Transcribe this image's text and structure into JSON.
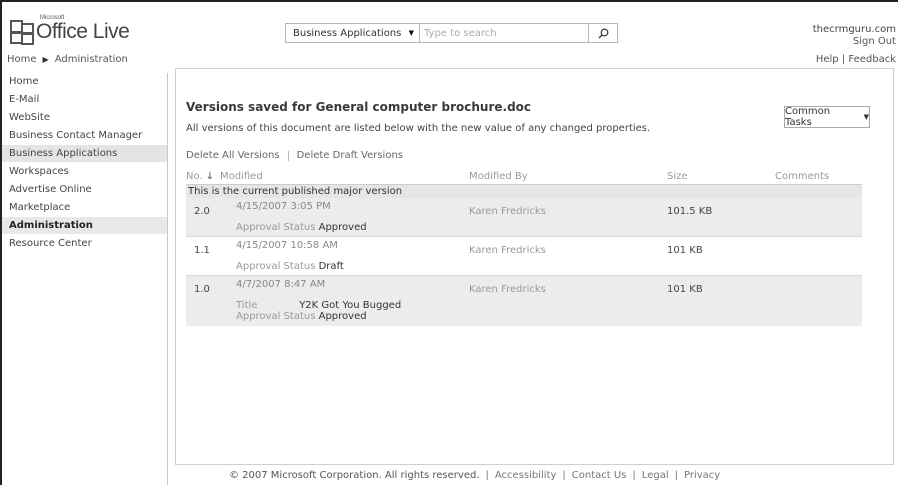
{
  "header": {
    "logo_ms": "Microsoft",
    "logo_text": "Office Live",
    "breadcrumb": [
      "Home",
      "Administration"
    ],
    "search": {
      "scope": "Business Applications",
      "placeholder": "Type to search"
    },
    "user": {
      "domain": "thecrmguru.com",
      "sign_out": "Sign Out",
      "help": "Help",
      "feedback": "Feedback"
    }
  },
  "sidebar": {
    "items": [
      {
        "label": "Home"
      },
      {
        "label": "E-Mail"
      },
      {
        "label": "WebSite"
      },
      {
        "label": "Business Contact Manager"
      },
      {
        "label": "Business Applications"
      },
      {
        "label": "Workspaces"
      },
      {
        "label": "Advertise Online"
      },
      {
        "label": "Marketplace"
      },
      {
        "label": "Administration"
      },
      {
        "label": "Resource Center"
      }
    ]
  },
  "main": {
    "title": "Versions saved for General computer brochure.doc",
    "description": "All versions of this document are listed below with the new value of any changed properties.",
    "common_tasks": "Common Tasks",
    "actions": [
      "Delete All Versions",
      "Delete Draft Versions"
    ],
    "columns": {
      "no": "No.",
      "modified": "Modified",
      "modified_by": "Modified By",
      "size": "Size",
      "comments": "Comments"
    },
    "group_label": "This is the current published major version",
    "versions": [
      {
        "no": "2.0",
        "modified": "4/15/2007 3:05 PM",
        "modified_by": "Karen Fredricks",
        "size": "101.5 KB",
        "props": [
          {
            "name": "Approval Status",
            "value": "Approved"
          }
        ]
      },
      {
        "no": "1.1",
        "modified": "4/15/2007 10:58 AM",
        "modified_by": "Karen Fredricks",
        "size": "101 KB",
        "props": [
          {
            "name": "Approval Status",
            "value": "Draft"
          }
        ]
      },
      {
        "no": "1.0",
        "modified": "4/7/2007 8:47 AM",
        "modified_by": "Karen Fredricks",
        "size": "101 KB",
        "props": [
          {
            "name": "Title",
            "value": "Y2K Got You Bugged"
          },
          {
            "name": "Approval Status",
            "value": "Approved"
          }
        ]
      }
    ]
  },
  "footer": {
    "copyright": "© 2007 Microsoft Corporation. All rights reserved.",
    "links": [
      "Accessibility",
      "Contact Us",
      "Legal",
      "Privacy"
    ]
  }
}
